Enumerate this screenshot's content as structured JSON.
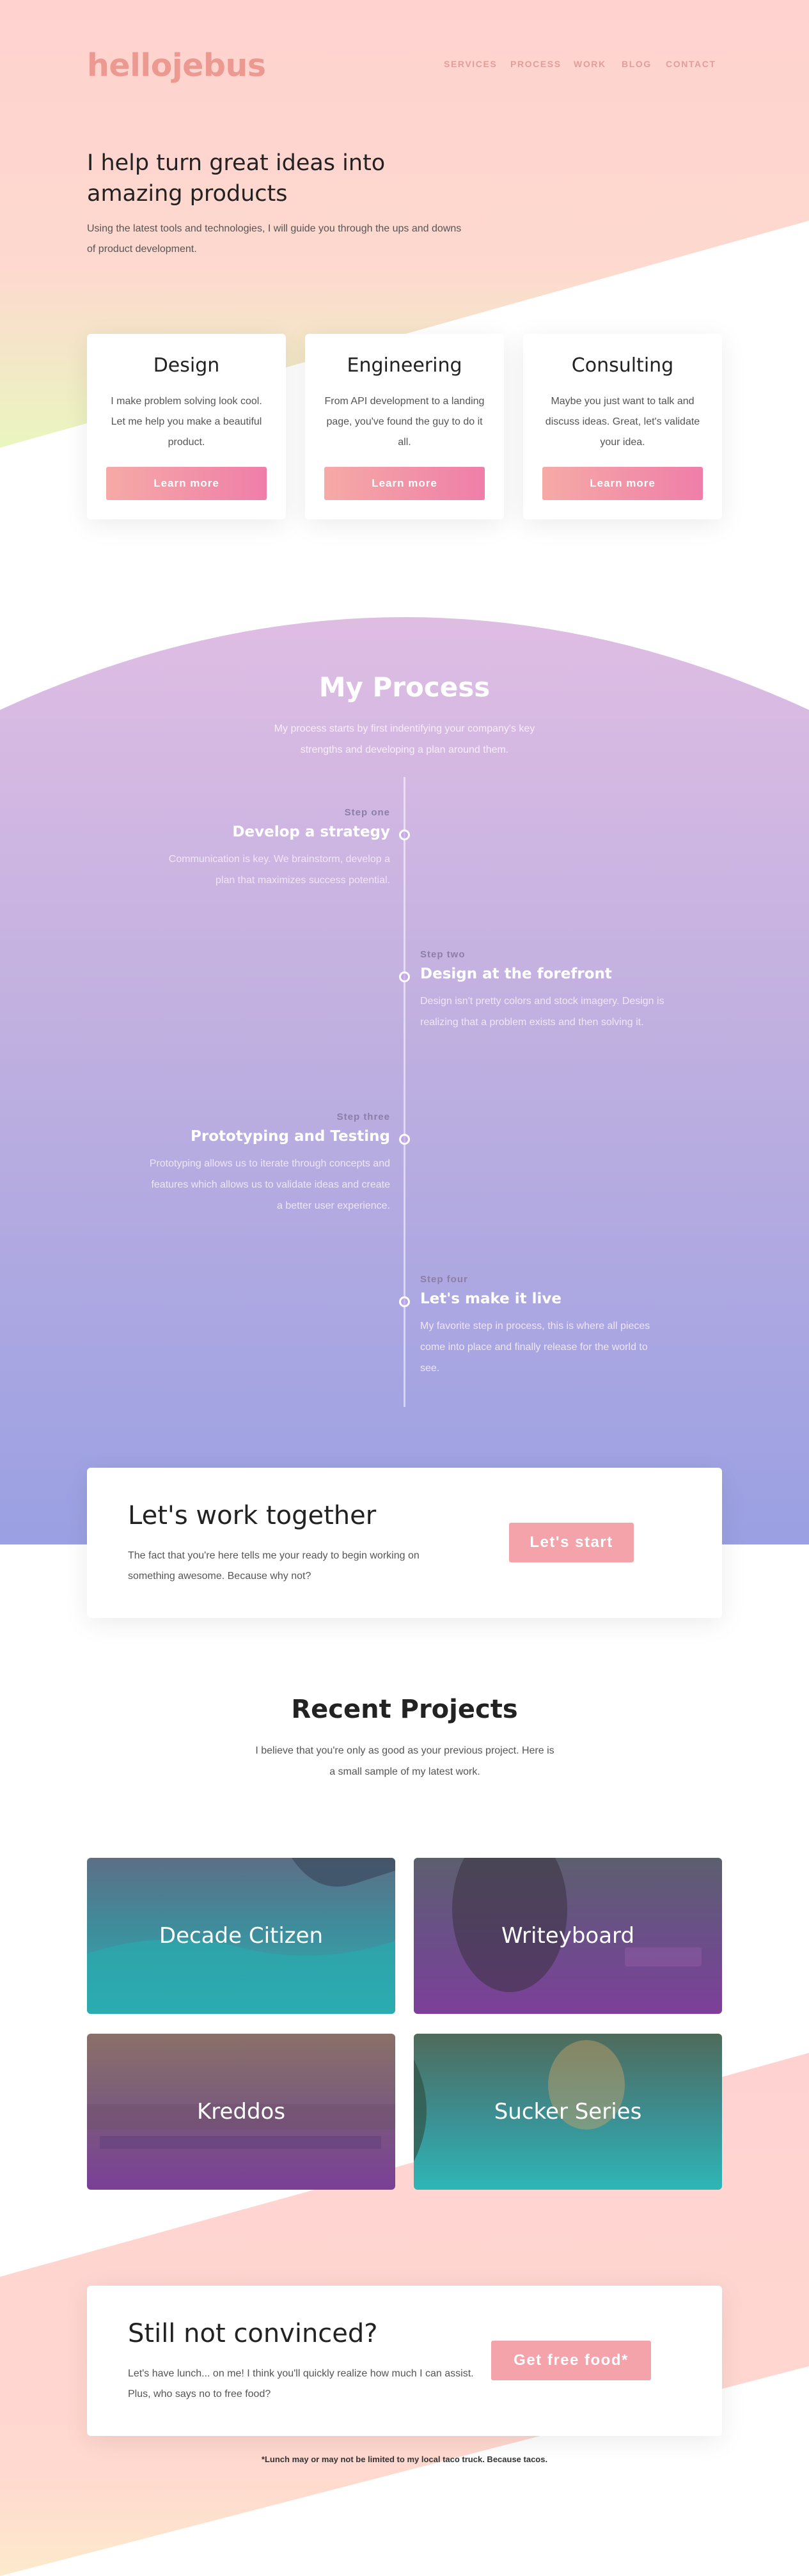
{
  "brand": {
    "logo": "hellojebus"
  },
  "nav": {
    "items": [
      "SERVICES",
      "PROCESS",
      "WORK",
      "BLOG",
      "CONTACT"
    ]
  },
  "hero": {
    "title": "I help turn great ideas into amazing products",
    "subtitle": "Using the latest tools and technologies, I will guide you through the ups and downs of product development."
  },
  "services": [
    {
      "title": "Design",
      "description": "I make problem solving look cool. Let me help you make a beautiful product.",
      "button": "Learn more"
    },
    {
      "title": "Engineering",
      "description": "From API development to a landing page, you've found the guy to do it all.",
      "button": "Learn more"
    },
    {
      "title": "Consulting",
      "description": "Maybe you just want to talk and discuss ideas. Great, let's validate your idea.",
      "button": "Learn more"
    }
  ],
  "process": {
    "title": "My Process",
    "subtitle": "My process starts by first indentifying your company's key strengths and developing a plan around them.",
    "steps": [
      {
        "number": "Step one",
        "title": "Develop a strategy",
        "description": "Communication is key. We brainstorm, develop a plan that maximizes success potential."
      },
      {
        "number": "Step two",
        "title": "Design at the forefront",
        "description": "Design isn't pretty colors and stock imagery. Design is realizing that a problem exists and then solving it."
      },
      {
        "number": "Step three",
        "title": "Prototyping and Testing",
        "description": "Prototyping allows us to iterate through concepts and features which allows us to validate ideas and create a better user experience."
      },
      {
        "number": "Step four",
        "title": "Let's make it live",
        "description": "My favorite step in process, this is where all pieces come into place and finally release for the world to see."
      }
    ]
  },
  "work_together": {
    "title": "Let's work together",
    "description": "The fact that you're here tells me your ready to begin working on something awesome. Because why not?",
    "button": "Let's start"
  },
  "projects": {
    "title": "Recent Projects",
    "subtitle": "I believe that you're only as good as your previous project. Here is a small sample of my latest work.",
    "items": [
      {
        "name": "Decade Citizen"
      },
      {
        "name": "Writeyboard"
      },
      {
        "name": "Kreddos"
      },
      {
        "name": "Sucker Series"
      }
    ]
  },
  "not_convinced": {
    "title": "Still not convinced?",
    "description": "Let's have lunch... on me! I think you'll quickly realize how much I can assist. Plus, who says no to free food?",
    "button": "Get free food*",
    "footnote": "*Lunch may or may not be limited to my local taco truck. Because tacos."
  },
  "colors": {
    "accent": "#f5a3ab",
    "logo": "#ec9a91",
    "hero_pink": "#ffd2cf",
    "process_top": "#dcbbe4",
    "process_bottom": "#9aa0e3"
  }
}
